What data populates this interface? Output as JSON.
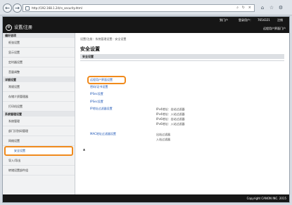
{
  "browser": {
    "url": "http://192.168.1.24/rs_security.html",
    "back": "←",
    "forward": "→"
  },
  "topbar": {
    "portal": "到门户",
    "user_label": "登录用户：",
    "user_id": "7654321",
    "logout": "注销"
  },
  "header": {
    "title": "设置/注册",
    "remote": "远程用户界面门户"
  },
  "sidebar": {
    "sections": [
      {
        "label": "偏好选项",
        "items": [
          "纸张设置",
          "显示设置",
          "定时器设置",
          "音量调整"
        ]
      },
      {
        "label": "详细设置",
        "items": [
          "常规设置",
          "存储介质管理器",
          "打印机设置"
        ]
      },
      {
        "label": "系统管理设置",
        "items": [
          "系统管理",
          "部门识别码管理",
          "网络设置",
          "安全设置",
          "导入/导出",
          "转储设置部件组"
        ]
      }
    ]
  },
  "main": {
    "breadcrumb": "设置/注册：系统管理设置：安全设置",
    "title": "安全设置",
    "group": "安全设置",
    "links": [
      "远程用户界面设置",
      "密码/证书设置",
      "IPSec设置",
      "IPSec设置",
      "IP地址过滤器设置",
      "MAC地址过滤器设置"
    ],
    "ipv4_out": "IPv4地址：出站过滤器",
    "ipv4_in": "IPv4地址：入站过滤器",
    "ipv6_out": "IPv6地址：出站过滤器",
    "ipv6_in": "IPv6地址：入站过滤器",
    "mac_out": "出站过滤器",
    "mac_in": "入站过滤器",
    "top": "▲"
  },
  "footer": {
    "copyright": "Copyright CANON INC. 2015"
  }
}
